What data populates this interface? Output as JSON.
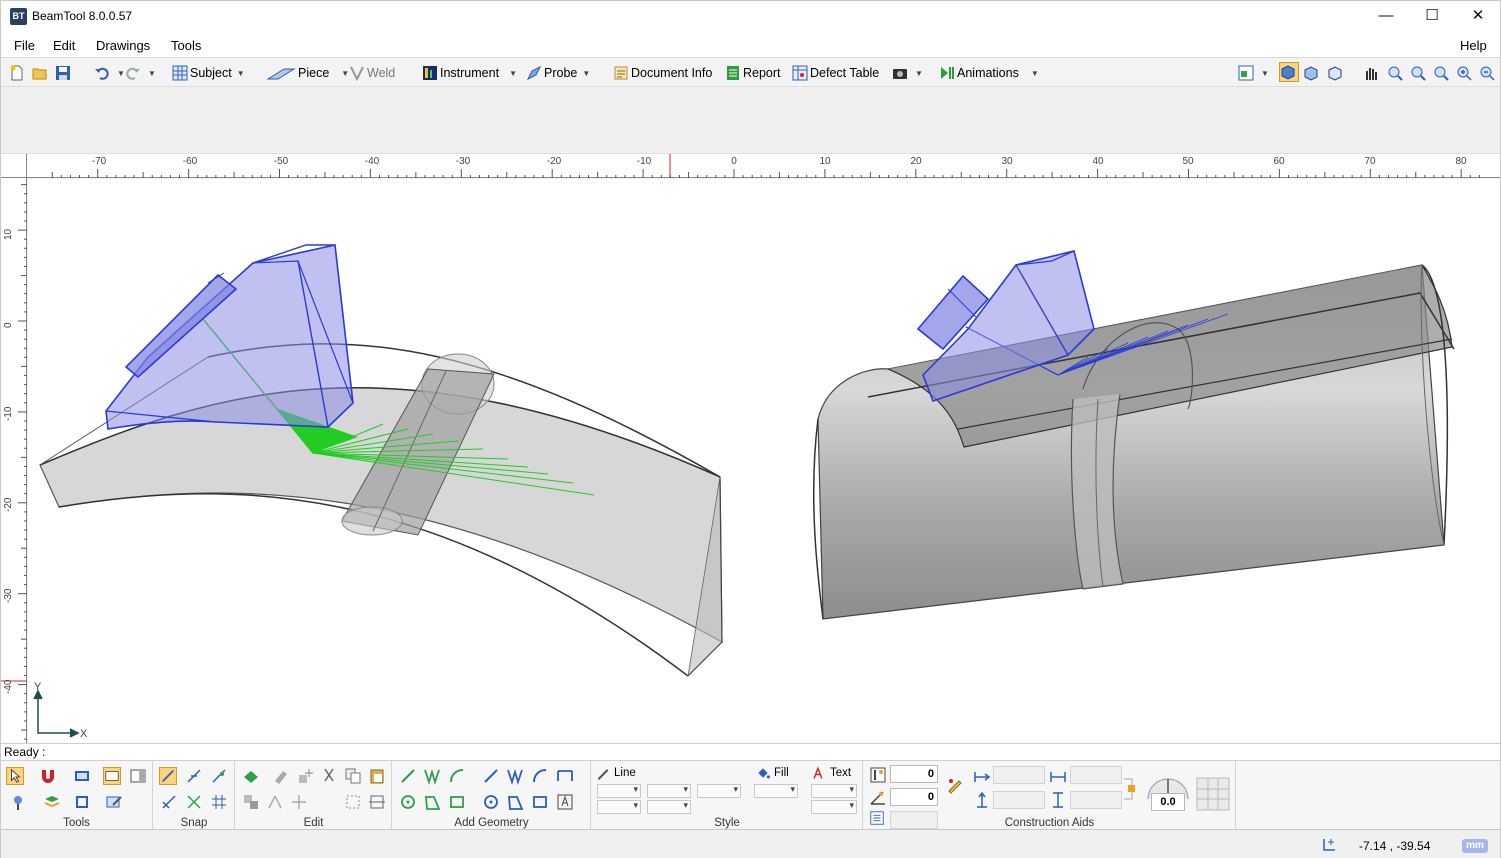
{
  "window": {
    "title": "BeamTool 8.0.0.57",
    "icon_text": "BT",
    "controls": {
      "minimize": "—",
      "maximize": "☐",
      "close": "✕"
    }
  },
  "menu": {
    "items": [
      "File",
      "Edit",
      "Drawings",
      "Tools"
    ],
    "help": "Help"
  },
  "toolbar": {
    "subject": "Subject",
    "piece": "Piece",
    "weld": "Weld",
    "instrument": "Instrument",
    "probe": "Probe",
    "document_info": "Document Info",
    "report": "Report",
    "defect_table": "Defect Table",
    "animations": "Animations"
  },
  "ruler": {
    "h_labels": [
      "-70",
      "-60",
      "-50",
      "-40",
      "-30",
      "-20",
      "-10",
      "0",
      "10",
      "20",
      "30",
      "40",
      "50",
      "60",
      "70",
      "80"
    ],
    "v_labels": [
      "10",
      "0",
      "-10",
      "-20",
      "-30",
      "-40"
    ]
  },
  "axes": {
    "y": "Y",
    "x": "X"
  },
  "status": {
    "ready": "Ready :",
    "coords": "-7.14 , -39.54",
    "units": "mm"
  },
  "ribbon": {
    "groups": {
      "tools": "Tools",
      "snap": "Snap",
      "edit": "Edit",
      "add_geometry": "Add Geometry",
      "style": "Style",
      "construction_aids": "Construction Aids"
    },
    "style": {
      "line": "Line",
      "fill": "Fill",
      "text": "Text"
    },
    "fields": {
      "field1": "0",
      "field2": "0",
      "angle": "0.0"
    }
  },
  "colors": {
    "accent": "#2a3bd6",
    "probe_fill": "#8c8ee6",
    "beam_green": "#22cc22",
    "piece_gray": "#9a9a9a",
    "ruler_mark": "#e02020"
  }
}
